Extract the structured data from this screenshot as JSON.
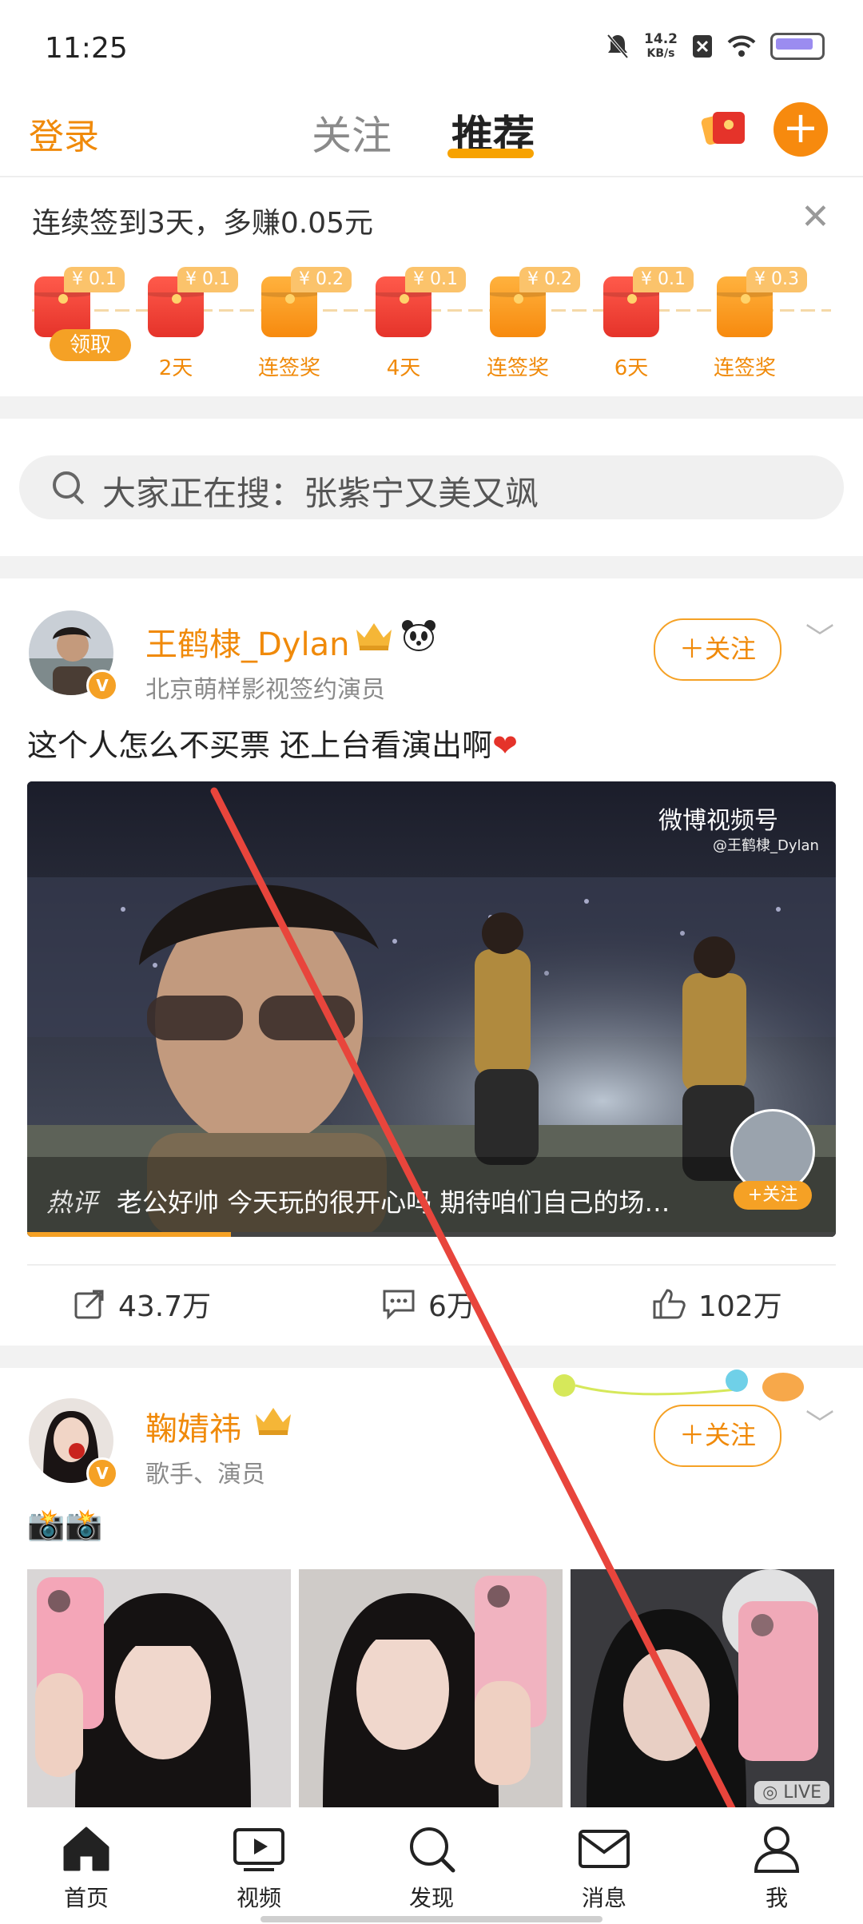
{
  "status_bar": {
    "time": "11:25",
    "net_speed_value": "14.2",
    "net_speed_unit": "KB/s"
  },
  "top_nav": {
    "login": "登录",
    "tab_follow": "关注",
    "tab_recommend": "推荐",
    "add_symbol": "+"
  },
  "signin": {
    "title": "连续签到3天，多赚0.05元",
    "claim_label": "领取",
    "days": [
      {
        "amount": "¥ 0.1",
        "label": "",
        "color": "red"
      },
      {
        "amount": "¥ 0.1",
        "label": "2天",
        "color": "red"
      },
      {
        "amount": "¥ 0.2",
        "label": "连签奖",
        "color": "orange"
      },
      {
        "amount": "¥ 0.1",
        "label": "4天",
        "color": "red"
      },
      {
        "amount": "¥ 0.2",
        "label": "连签奖",
        "color": "orange"
      },
      {
        "amount": "¥ 0.1",
        "label": "6天",
        "color": "red"
      },
      {
        "amount": "¥ 0.3",
        "label": "连签奖",
        "color": "orange"
      }
    ]
  },
  "search": {
    "text": "大家正在搜：张紫宁又美又飒"
  },
  "post1": {
    "username": "王鹤棣_Dylan",
    "subtitle": "北京萌样影视签约演员",
    "follow_label": "关注",
    "text": "这个人怎么不买票 还上台看演出啊",
    "video": {
      "watermark": "微博视频号",
      "watermark_handle": "@王鹤棣_Dylan",
      "hot_label": "热评",
      "hot_comment": "老公好帅 今天玩的很开心吗 期待咱们自己的场…",
      "mini_follow": "+关注"
    },
    "reposts": "43.7万",
    "comments": "6万",
    "likes": "102万"
  },
  "post2": {
    "username": "鞠婧祎",
    "subtitle": "歌手、演员",
    "follow_label": "关注",
    "text": "📸📸",
    "live_badge": "LIVE"
  },
  "bottom_nav": {
    "home": "首页",
    "video": "视频",
    "discover": "发现",
    "messages": "消息",
    "me": "我"
  },
  "colors": {
    "brand": "#f08a0a",
    "accent": "#f5a125",
    "annotation_arrow": "#e8453c"
  }
}
